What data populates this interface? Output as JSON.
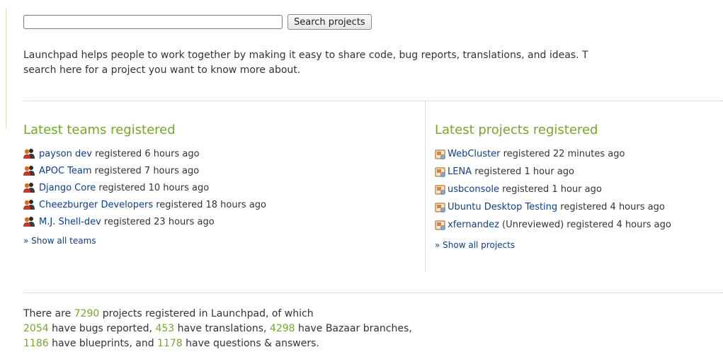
{
  "search": {
    "input_value": "",
    "button_label": "Search projects"
  },
  "intro": {
    "line1": "Launchpad helps people to work together by making it easy to share code, bug reports, translations, and ideas. T",
    "line2": "search here for a project you want to know more about."
  },
  "teams": {
    "heading": "Latest teams registered",
    "icon": "team-icon",
    "items": [
      {
        "name": "payson dev",
        "suffix": " registered 6 hours ago"
      },
      {
        "name": "APOC Team",
        "suffix": " registered 7 hours ago"
      },
      {
        "name": "Django Core",
        "suffix": " registered 10 hours ago"
      },
      {
        "name": "Cheezburger Developers",
        "suffix": " registered 18 hours ago"
      },
      {
        "name": "M.J. Shell-dev",
        "suffix": " registered 23 hours ago"
      }
    ],
    "show_all": "» Show all teams"
  },
  "projects": {
    "heading": "Latest projects registered",
    "icon": "project-icon",
    "items": [
      {
        "name": "WebCluster",
        "suffix": " registered 22 minutes ago"
      },
      {
        "name": "LENA",
        "suffix": " registered 1 hour ago"
      },
      {
        "name": "usbconsole",
        "suffix": " registered 1 hour ago"
      },
      {
        "name": "Ubuntu Desktop Testing",
        "suffix": " registered 4 hours ago"
      },
      {
        "name": "xfernandez",
        "suffix": " (Unreviewed) registered 4 hours ago"
      }
    ],
    "show_all": "» Show all projects"
  },
  "stats": {
    "t1": "There are ",
    "projects_count": "7290",
    "t2": " projects registered in Launchpad, of which",
    "bugs_count": "2054",
    "t3": " have bugs reported, ",
    "translations_count": "453",
    "t4": " have translations, ",
    "branches_count": "4298",
    "t5": " have Bazaar branches,",
    "blueprints_count": "1186",
    "t6": " have blueprints, and ",
    "questions_count": "1178",
    "t7": " have questions & answers."
  },
  "colors": {
    "accent_green": "#74a82b",
    "link_blue": "#0c3f8c",
    "text": "#333333"
  }
}
